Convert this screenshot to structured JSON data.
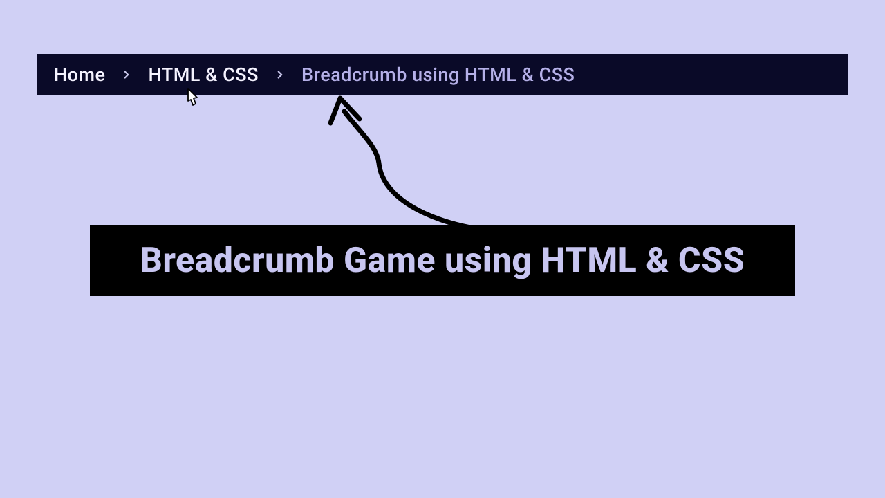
{
  "breadcrumb": {
    "items": [
      {
        "label": "Home",
        "type": "link"
      },
      {
        "label": "HTML & CSS",
        "type": "link"
      },
      {
        "label": "Breadcrumb using HTML & CSS",
        "type": "current"
      }
    ]
  },
  "title": {
    "text": "Breadcrumb Game using HTML & CSS"
  }
}
